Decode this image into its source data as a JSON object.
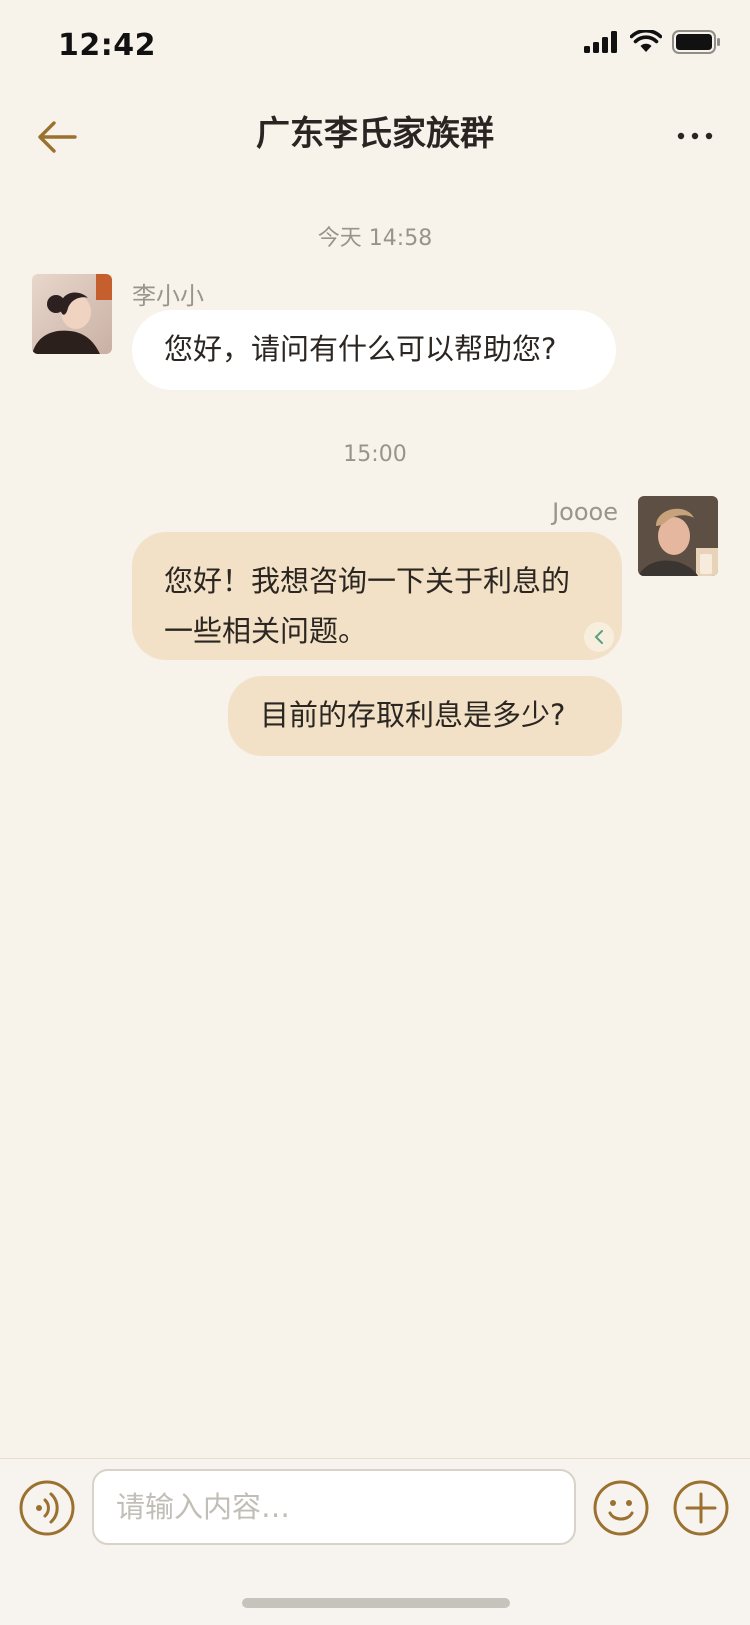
{
  "status": {
    "time": "12:42"
  },
  "header": {
    "title": "广东李氏家族群"
  },
  "messages": [
    {
      "type": "time",
      "text": "今天 14:58"
    },
    {
      "type": "incoming",
      "sender": "李小小",
      "text": "您好，请问有什么可以帮助您?"
    },
    {
      "type": "time",
      "text": "15:00"
    },
    {
      "type": "outgoing",
      "sender": "Joooe",
      "line1": "您好！我想咨询一下关于利息的",
      "line2": "一些相关问题。"
    },
    {
      "type": "outgoing",
      "text": "目前的存取利息是多少?"
    }
  ],
  "composer": {
    "placeholder": "请输入内容…"
  },
  "colors": {
    "accent": "#9B7130",
    "background": "#F7F2EA",
    "outgoing_bubble": "#F2E1C6",
    "incoming_bubble": "#FFFFFF"
  }
}
